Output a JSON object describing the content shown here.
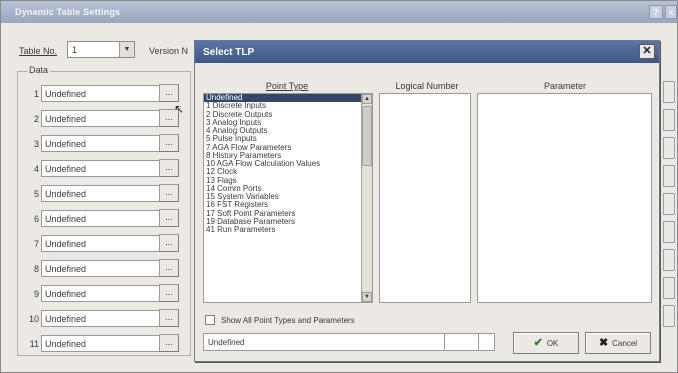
{
  "window": {
    "title": "Dynamic Table Settings",
    "help_label": "?",
    "close_label": "x"
  },
  "table_no": {
    "label": "Table No.",
    "value": "1",
    "version_label": "Version N"
  },
  "data_group": {
    "label": "Data",
    "rows": [
      {
        "num": "1",
        "value": "Undefined"
      },
      {
        "num": "2",
        "value": "Undefined"
      },
      {
        "num": "3",
        "value": "Undefined"
      },
      {
        "num": "4",
        "value": "Undefined"
      },
      {
        "num": "5",
        "value": "Undefined"
      },
      {
        "num": "6",
        "value": "Undefined"
      },
      {
        "num": "7",
        "value": "Undefined"
      },
      {
        "num": "8",
        "value": "Undefined"
      },
      {
        "num": "9",
        "value": "Undefined"
      },
      {
        "num": "10",
        "value": "Undefined"
      },
      {
        "num": "11",
        "value": "Undefined"
      }
    ],
    "browse_label": "..."
  },
  "dialog": {
    "title": "Select TLP",
    "close_label": "✕",
    "headers": {
      "point_type": "Point Type",
      "logical_number": "Logical Number",
      "parameter": "Parameter"
    },
    "point_types": [
      "Undefined",
      "1 Discrete Inputs",
      "2 Discrete Outputs",
      "3 Analog Inputs",
      "4 Analog Outputs",
      "5 Pulse Inputs",
      "7 AGA Flow Parameters",
      "8 History Parameters",
      "10 AGA Flow Calculation Values",
      "12 Clock",
      "13 Flags",
      "14 Comm Ports",
      "15 System Variables",
      "16 FST Registers",
      "17 Soft Point Parameters",
      "19 Database Parameters",
      "41 Run Parameters"
    ],
    "selected_index": 0,
    "checkbox_label": "Show All Point Types and Parameters",
    "status_value": "Undefined",
    "ok_label": "OK",
    "cancel_label": "Cancel"
  }
}
